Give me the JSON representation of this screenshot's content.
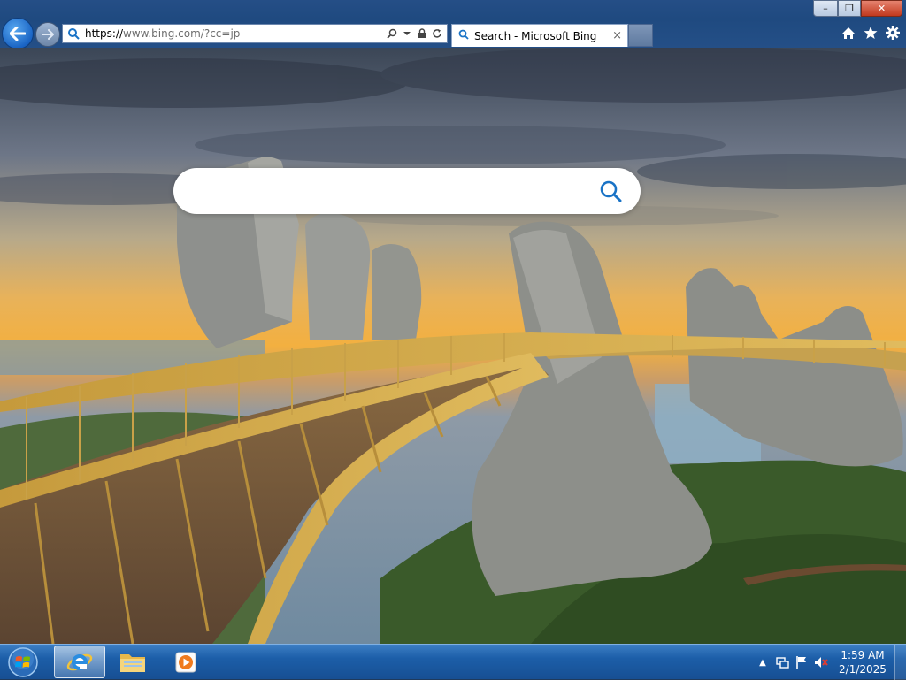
{
  "window": {
    "controls": {
      "minimize": "–",
      "maximize": "❐",
      "close": "✕"
    }
  },
  "navigation": {
    "back_icon": "back-arrow-icon",
    "forward_icon": "forward-arrow-icon"
  },
  "address_bar": {
    "url_scheme": "https://",
    "url_host": "www.bing.com",
    "url_path": "/?cc=jp",
    "tools": [
      "search-icon",
      "dropdown-icon",
      "lock-icon",
      "refresh-icon"
    ]
  },
  "tabs": [
    {
      "label": "Search - Microsoft Bing",
      "close": "×"
    }
  ],
  "toolbar_right": [
    "home-icon",
    "favorites-star-icon",
    "settings-gear-icon"
  ],
  "page": {
    "search_placeholder": "",
    "search_value": "",
    "accent_color": "#1a73c6"
  },
  "taskbar": {
    "pinned": [
      "internet-explorer",
      "file-explorer",
      "media-player"
    ],
    "active": "internet-explorer",
    "tray": {
      "show_hidden": "▲",
      "clock_time": "1:59 AM",
      "clock_date": "2/1/2025"
    }
  },
  "colors": {
    "title_bar": "#244f87",
    "taskbar": "#1c5ea8",
    "close_button": "#c2391e"
  }
}
